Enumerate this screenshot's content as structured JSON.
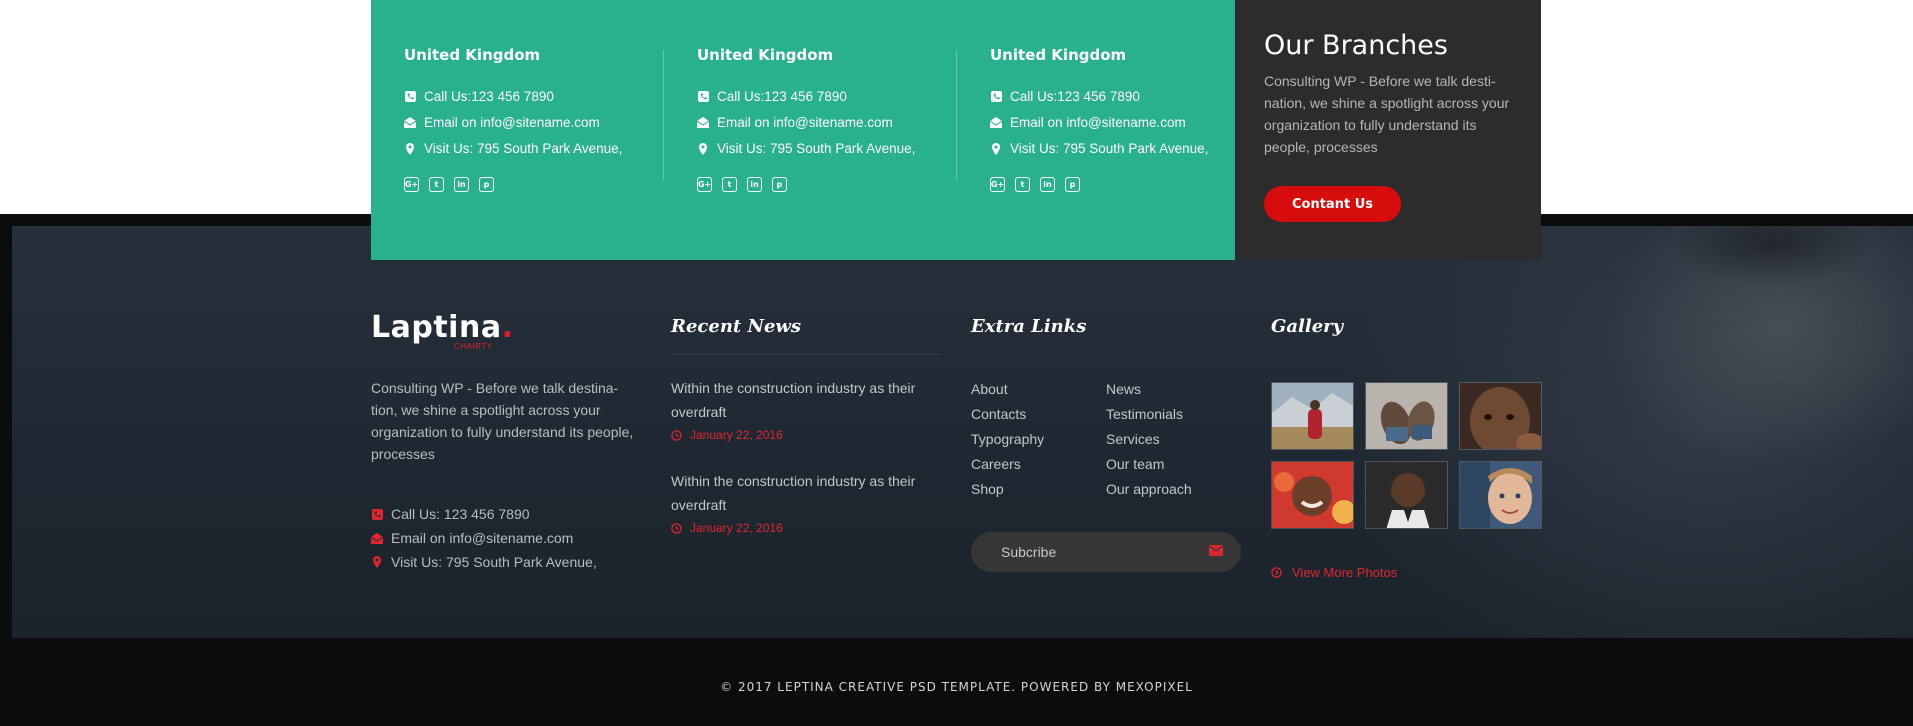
{
  "branches": [
    {
      "title": "United Kingdom",
      "phone": "Call Us:123 456 7890",
      "email": "Email on info@sitename.com",
      "address": "Visit Us: 795 South Park Avenue,",
      "social": [
        "G+",
        "t",
        "in",
        "p"
      ]
    },
    {
      "title": "United Kingdom",
      "phone": "Call Us:123 456 7890",
      "email": "Email on info@sitename.com",
      "address": "Visit Us: 795 South Park Avenue,",
      "social": [
        "G+",
        "t",
        "in",
        "p"
      ]
    },
    {
      "title": "United Kingdom",
      "phone": "Call Us:123 456 7890",
      "email": "Email on info@sitename.com",
      "address": "Visit Us: 795 South Park Avenue,",
      "social": [
        "G+",
        "t",
        "in",
        "p"
      ]
    }
  ],
  "branches_info": {
    "title": "Our Branches",
    "text": "Consulting WP - Before we talk desti-nation, we shine a spotlight across your organization to fully understand its people, processes",
    "button": "Contant Us"
  },
  "footer": {
    "logo": {
      "name": "Laptina",
      "dot": ".",
      "tagline": "CHAIRTY"
    },
    "about": "Consulting WP - Before we talk destina-tion, we shine a spotlight across your organization to fully understand its people, processes",
    "contact": {
      "phone": "Call Us: 123 456 7890",
      "email": "Email on info@sitename.com",
      "address": "Visit Us: 795 South Park Avenue,"
    },
    "recent_news": {
      "heading": "Recent News",
      "items": [
        {
          "title": "Within the construction industry as their overdraft",
          "date": "January 22, 2016"
        },
        {
          "title": "Within the construction industry as their overdraft",
          "date": "January 22, 2016"
        }
      ]
    },
    "extra_links": {
      "heading": "Extra Links",
      "col1": [
        "About",
        "Contacts",
        "Typography",
        "Careers",
        "Shop"
      ],
      "col2": [
        "News",
        "Testimonials",
        "Services",
        "Our team",
        "Our approach"
      ],
      "subscribe": "Subcribe"
    },
    "gallery": {
      "heading": "Gallery",
      "more": "View More Photos"
    }
  },
  "copyright": "© 2017 LEPTINA CREATIVE PSD TEMPLATE. POWERED BY MEXOPIXEL",
  "colors": {
    "green": "#29b08d",
    "accent_red": "#e0262f",
    "button_red": "#d70c0c",
    "dark_box": "#2c2c2c",
    "footer_bg": "#0b0c0e"
  }
}
